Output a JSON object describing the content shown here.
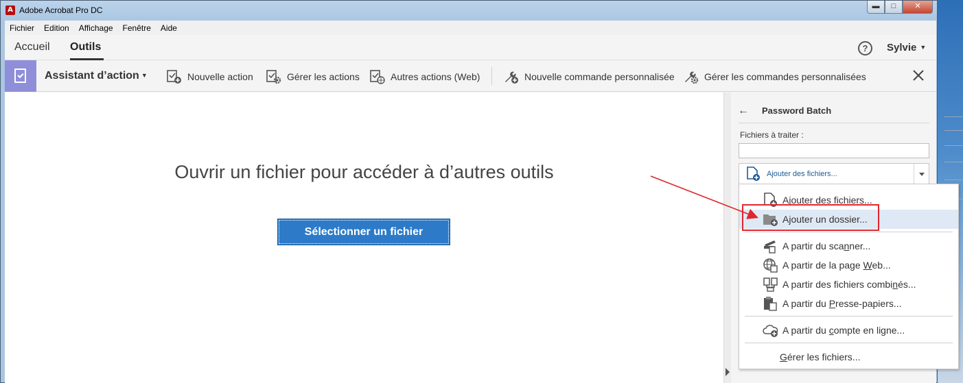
{
  "window": {
    "title": "Adobe Acrobat Pro DC",
    "app_icon": "acrobat-icon",
    "controls": {
      "minimize": "▬",
      "maximize": "□",
      "close": "✕"
    }
  },
  "menubar": {
    "items": [
      "Fichier",
      "Edition",
      "Affichage",
      "Fenêtre",
      "Aide"
    ]
  },
  "topnav": {
    "tabs": [
      {
        "label": "Accueil",
        "active": false
      },
      {
        "label": "Outils",
        "active": true
      }
    ],
    "help": "?",
    "user": "Sylvie"
  },
  "toolbar": {
    "title": "Assistant d’action",
    "items": [
      {
        "label": "Nouvelle action",
        "icon": "new-action-icon"
      },
      {
        "label": "Gérer les actions",
        "icon": "manage-actions-icon"
      },
      {
        "label": "Autres actions (Web)",
        "icon": "web-actions-icon"
      },
      {
        "label": "Nouvelle commande personnalisée",
        "icon": "wrench-add-icon"
      },
      {
        "label": "Gérer les commandes personnalisées",
        "icon": "wrench-gear-icon"
      }
    ]
  },
  "main": {
    "heading": "Ouvrir un fichier pour accéder à d’autres outils",
    "button": "Sélectionner un fichier"
  },
  "rightpanel": {
    "back": "←",
    "title": "Password Batch",
    "files_label": "Fichiers à traiter :",
    "add_button": "Ajouter des fichiers..."
  },
  "dropdown": {
    "items": [
      {
        "pre": "Ajouter des fichiers...",
        "u": "",
        "post": "",
        "icon": "add-file-icon"
      },
      {
        "pre": "Ajouter un dossier...",
        "u": "",
        "post": "",
        "icon": "add-folder-icon",
        "highlighted": true
      },
      {
        "pre": "A partir du sca",
        "u": "n",
        "post": "ner...",
        "icon": "scanner-icon"
      },
      {
        "pre": "A partir de la page ",
        "u": "W",
        "post": "eb...",
        "icon": "web-page-icon"
      },
      {
        "pre": "A partir des fichiers combi",
        "u": "n",
        "post": "és...",
        "icon": "combine-files-icon"
      },
      {
        "pre": "A partir du ",
        "u": "P",
        "post": "resse-papiers...",
        "icon": "clipboard-icon"
      },
      {
        "pre": "A partir du ",
        "u": "c",
        "post": "ompte en ligne...",
        "icon": "cloud-icon"
      },
      {
        "pre": "",
        "u": "G",
        "post": "érer les fichiers...",
        "icon": ""
      }
    ]
  },
  "colors": {
    "accent_blue": "#2d7bc8",
    "tool_badge": "#8f8fd9",
    "annotation_red": "#e0262c"
  }
}
